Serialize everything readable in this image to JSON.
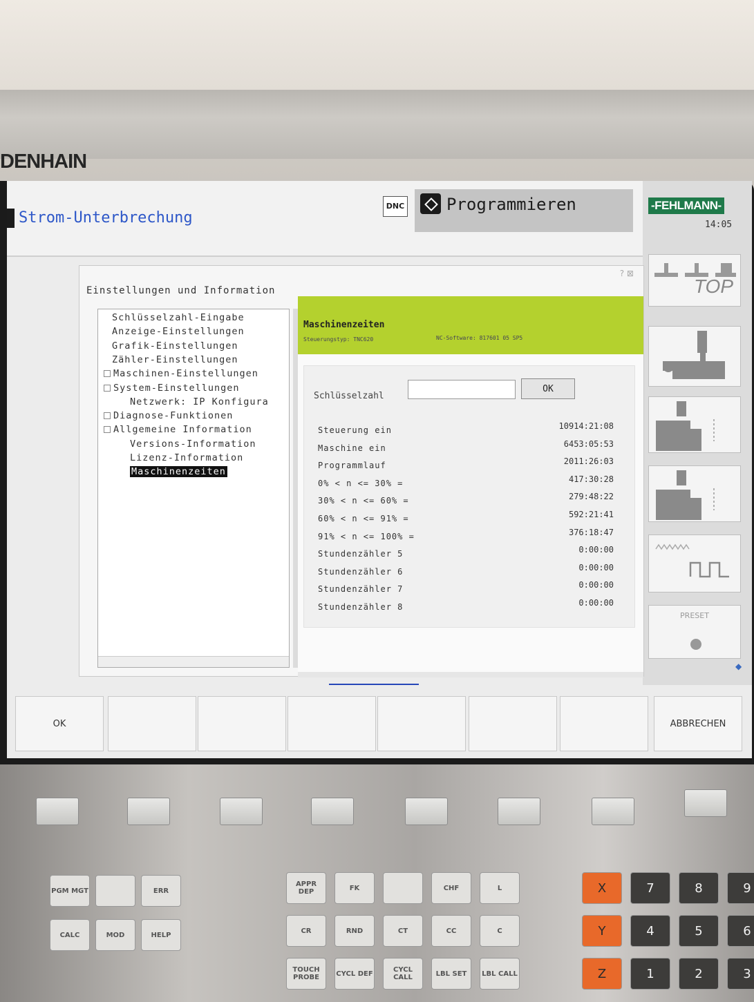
{
  "brand": "DENHAIN",
  "header": {
    "mode_left": "Strom-Unterbrechung",
    "dnc_label": "DNC",
    "mode_right": "Programmieren",
    "logo": "-FEHLMANN-",
    "time": "14:05"
  },
  "side_buttons": {
    "top_label": "TOP",
    "preset_label": "PRESET"
  },
  "dialog": {
    "title": "Einstellungen und Information",
    "tree": [
      {
        "label": "Schlüsselzahl-Eingabe",
        "indent": 1,
        "expander": false,
        "selected": false
      },
      {
        "label": "Anzeige-Einstellungen",
        "indent": 1,
        "expander": false,
        "selected": false
      },
      {
        "label": "Grafik-Einstellungen",
        "indent": 1,
        "expander": false,
        "selected": false
      },
      {
        "label": "Zähler-Einstellungen",
        "indent": 1,
        "expander": false,
        "selected": false
      },
      {
        "label": "Maschinen-Einstellungen",
        "indent": 0,
        "expander": true,
        "selected": false
      },
      {
        "label": "System-Einstellungen",
        "indent": 0,
        "expander": true,
        "selected": false
      },
      {
        "label": "Netzwerk: IP Konfigura",
        "indent": 2,
        "expander": false,
        "selected": false
      },
      {
        "label": "Diagnose-Funktionen",
        "indent": 0,
        "expander": true,
        "selected": false
      },
      {
        "label": "Allgemeine Information",
        "indent": 0,
        "expander": true,
        "selected": false
      },
      {
        "label": "Versions-Information",
        "indent": 2,
        "expander": false,
        "selected": false
      },
      {
        "label": "Lizenz-Information",
        "indent": 2,
        "expander": false,
        "selected": false
      },
      {
        "label": "Maschinenzeiten",
        "indent": 2,
        "expander": false,
        "selected": true
      }
    ],
    "panel": {
      "title": "Maschinenzeiten",
      "sub_left": "Steuerungstyp: TNC620",
      "sub_right": "NC-Software: 817601 05 SP5",
      "key_label": "Schlüsselzahl",
      "key_value": "",
      "ok_label": "OK",
      "rows": [
        {
          "label": "Steuerung ein",
          "value": "10914:21:08"
        },
        {
          "label": "Maschine ein",
          "value": "6453:05:53"
        },
        {
          "label": "Programmlauf",
          "value": "2011:26:03"
        },
        {
          "label": "0% < n <= 30% =",
          "value": "417:30:28"
        },
        {
          "label": "30% < n <= 60% =",
          "value": "279:48:22"
        },
        {
          "label": "60% < n <= 91% =",
          "value": "592:21:41"
        },
        {
          "label": "91% < n <= 100% =",
          "value": "376:18:47"
        },
        {
          "label": "Stundenzähler 5",
          "value": "0:00:00"
        },
        {
          "label": "Stundenzähler 6",
          "value": "0:00:00"
        },
        {
          "label": "Stundenzähler 7",
          "value": "0:00:00"
        },
        {
          "label": "Stundenzähler 8",
          "value": "0:00:00"
        }
      ]
    }
  },
  "softkeys": [
    "OK",
    "",
    "",
    "",
    "",
    "",
    "",
    "ABBRECHEN"
  ],
  "keyboard": {
    "left_keys": [
      "PGM MGT",
      "",
      "ERR",
      "CALC",
      "MOD",
      "HELP"
    ],
    "mid_keys": [
      "APPR DEP",
      "FK",
      "",
      "CHF",
      "L",
      "CR",
      "RND",
      "CT",
      "CC",
      "C",
      "TOUCH PROBE",
      "CYCL DEF",
      "CYCL CALL",
      "LBL SET",
      "LBL CALL"
    ],
    "axis_keys": [
      "X",
      "Y",
      "Z"
    ],
    "digit_keys": [
      "7",
      "8",
      "9",
      "4",
      "5",
      "6",
      "1",
      "2",
      "3"
    ]
  },
  "colors": {
    "panel_header": "#b4d12e",
    "mode_text": "#2d57c8",
    "selection": "#111111",
    "axis_key": "#e8692a"
  }
}
